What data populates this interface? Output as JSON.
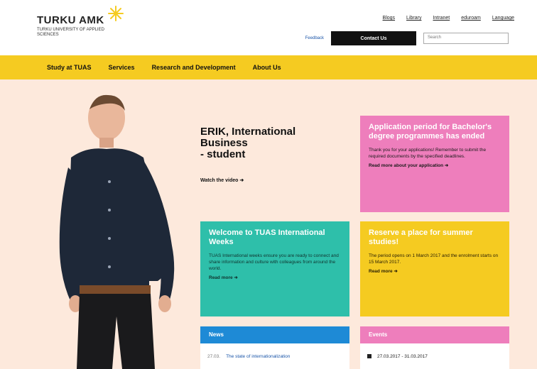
{
  "brand": {
    "name": "TURKU AMK",
    "subtitle": "TURKU UNIVERSITY OF APPLIED SCIENCES"
  },
  "top_links": [
    "Blogs",
    "Library",
    "Intranet",
    "eduroam",
    "Language"
  ],
  "utility": {
    "small_link": "Feedback",
    "contact_label": "Contact Us",
    "search_placeholder": "Search"
  },
  "nav": {
    "items": [
      "Study at TUAS",
      "Services",
      "Research and Development",
      "About Us"
    ]
  },
  "hero": {
    "title_line1": "ERIK, International",
    "title_line2": "Business",
    "title_line3": "- student",
    "watch_label": "Watch the video"
  },
  "cards": {
    "pink": {
      "title": "Application period for Bachelor's degree programmes has ended",
      "body": "Thank you for your applications! Remember to submit the required documents by the specified deadlines.",
      "more": "Read more about your application"
    },
    "teal": {
      "title": "Welcome to TUAS International Weeks",
      "body": "TUAS International weeks ensure you are ready to connect and share information and culture with colleagues from around the world.",
      "more": "Read more"
    },
    "yellow": {
      "title": "Reserve a place for summer studies!",
      "body": "The period opens on 1 March 2017 and the enrolment starts on 15 March 2017.",
      "more": "Read more"
    }
  },
  "news": {
    "heading": "News",
    "items": [
      {
        "date": "27.03.",
        "title": "The state of internationalization"
      }
    ]
  },
  "events": {
    "heading": "Events",
    "items": [
      {
        "dates": "27.03.2017 - 31.03.2017"
      }
    ]
  },
  "colors": {
    "nav_yellow": "#f5cb21",
    "hero_bg": "#fde9dc",
    "pink": "#ee7ebc",
    "teal": "#2ebfaa",
    "blue": "#1e8ad6"
  }
}
